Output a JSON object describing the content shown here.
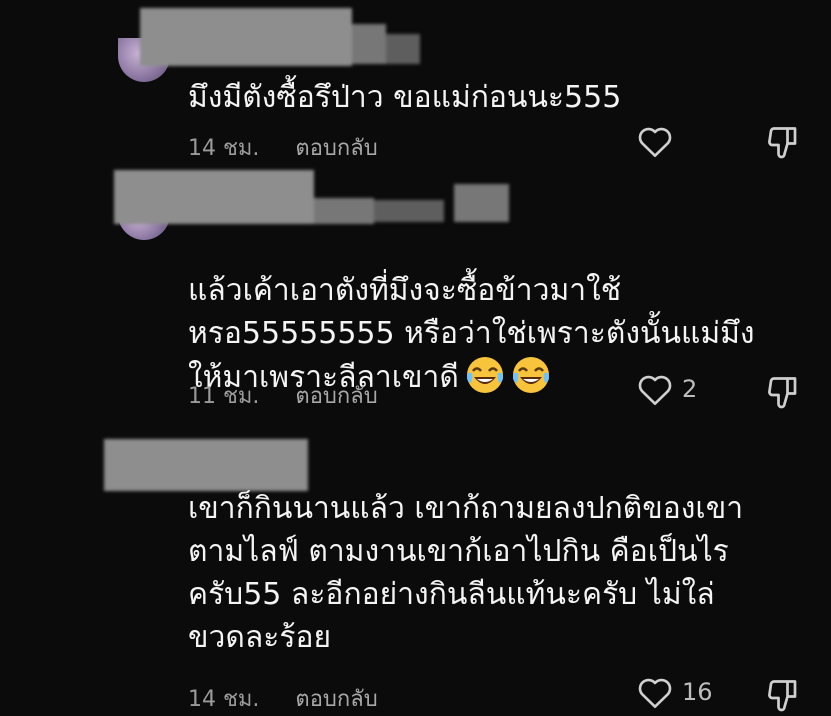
{
  "comments": [
    {
      "text": "มึงมีตังซื้อรึป่าว ขอแม่ก่อนนะ555",
      "time": "14 ชม.",
      "reply_label": "ตอบกลับ",
      "likes": ""
    },
    {
      "text": "แล้วเค้าเอาตังที่มึงจะซื้อข้าวมาใช้\nหรอ55555555 หรือว่าใช่เพราะตังนั้นแม่มึง\nให้มาเพราะลีลาเขาดี",
      "time": "11 ชม.",
      "reply_label": "ตอบกลับ",
      "likes": "2",
      "emoji": "face-with-tears-of-joy"
    },
    {
      "text": "เขาก็กินนานแล้ว เขาก้ถามยลงปกติของเขา\nตามไลฟ์ ตามงานเขาก้เอาไปกิน คือเป็นไร\nครับ55 ละอีกอย่างกินลีนแท้นะครับ ไม่ใล่\nขวดละร้อย",
      "time": "14 ชม.",
      "reply_label": "ตอบกลับ",
      "likes": "16"
    }
  ],
  "icons": {
    "like": "heart-outline-icon",
    "dislike": "thumbs-down-outline-icon"
  },
  "colors": {
    "background": "#0b0b0b",
    "text": "#f4f4f4",
    "meta": "#9a9a9a"
  }
}
